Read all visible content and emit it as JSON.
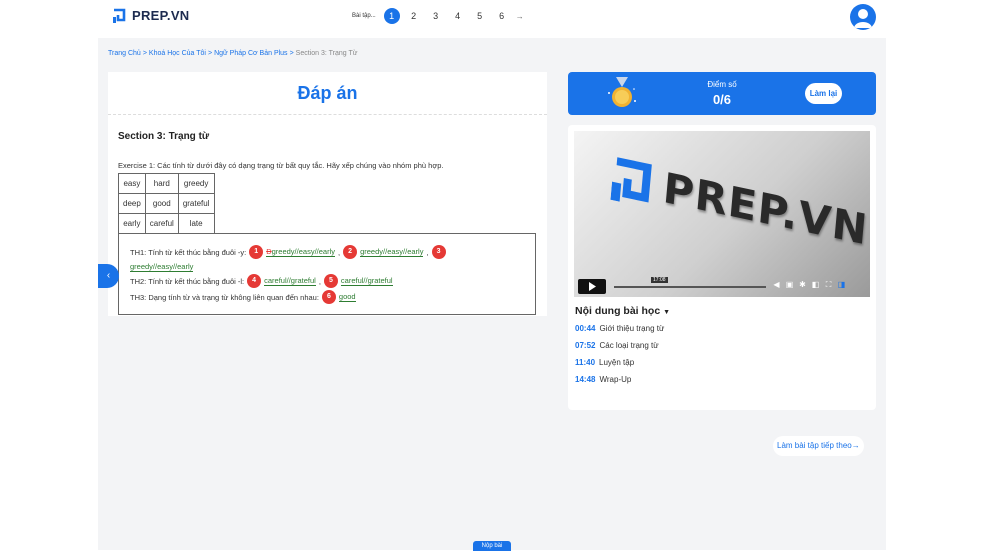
{
  "header": {
    "logo_text": "PREP.VN",
    "pager_label": "Bài tập...",
    "pages": [
      "1",
      "2",
      "3",
      "4",
      "5",
      "6"
    ],
    "active_page": "1",
    "next_arrow": "→"
  },
  "breadcrumb": {
    "items": [
      "Trang Chủ",
      "Khoá Học Của Tôi",
      "Ngữ Pháp Cơ Bản Plus"
    ],
    "current": "Section 3: Trạng Từ",
    "separator": ">"
  },
  "answer_panel": {
    "title": "Đáp án",
    "section_title": "Section 3: Trạng từ",
    "exercise": "Exercise 1: Các tính từ dưới đây có dạng trạng từ bất quy tắc. Hãy xếp chúng vào nhóm phù hợp.",
    "word_table": [
      [
        "easy",
        "hard",
        "greedy"
      ],
      [
        "deep",
        "good",
        "grateful"
      ],
      [
        "early",
        "careful",
        "late"
      ]
    ],
    "lines": {
      "th1_label": "TH1: Tính từ kết thúc bằng đuôi -y:",
      "th1_a1_num": "1",
      "th1_a1_strike": "Đ",
      "th1_a1": "greedy//easy//early",
      "th1_a2_num": "2",
      "th1_a2": "greedy//easy//early",
      "th1_a3_num": "3",
      "th1_a3": "greedy//easy//early",
      "th2_label": "TH2: Tính từ kết thúc bằng đuôi -l:",
      "th2_a4_num": "4",
      "th2_a4": "careful//grateful",
      "th2_a5_num": "5",
      "th2_a5": "careful//grateful",
      "th3_label": "TH3: Dạng tính từ và trạng từ không liên quan đến nhau:",
      "th3_a6_num": "6",
      "th3_a6": "good",
      "comma": ","
    },
    "side_tab_icon": "chevron-left-icon"
  },
  "score": {
    "label": "Điểm số",
    "value": "0/6",
    "retry_label": "Làm lại"
  },
  "video": {
    "logo_text": "PREP.VN",
    "current_time": "17:08"
  },
  "lesson": {
    "title": "Nội dung bài học",
    "chapters": [
      {
        "time": "00:44",
        "label": "Giới thiệu trạng từ"
      },
      {
        "time": "07:52",
        "label": "Các loại trạng từ"
      },
      {
        "time": "11:40",
        "label": "Luyện tập"
      },
      {
        "time": "14:48",
        "label": "Wrap-Up"
      }
    ]
  },
  "next_exercise": "Làm bài tập tiếp theo→",
  "bottom_button": "Nộp bài",
  "colors": {
    "accent": "#1a73e8",
    "answer_number": "#e53935",
    "correct": "#2e7d32"
  }
}
